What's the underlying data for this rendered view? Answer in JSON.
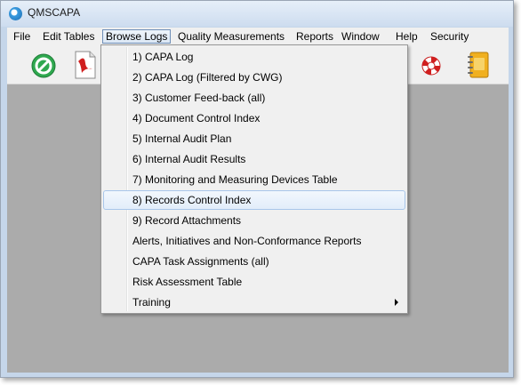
{
  "window": {
    "title": "QMSCAPA"
  },
  "menubar": [
    {
      "label": "File"
    },
    {
      "label": "Edit Tables"
    },
    {
      "label": "Browse Logs"
    },
    {
      "label": "Quality Measurements"
    },
    {
      "label": "Reports"
    },
    {
      "label": "Window"
    },
    {
      "label": "Help"
    },
    {
      "label": "Security"
    }
  ],
  "toolbar": {
    "buttons": [
      {
        "icon": "exit-icon",
        "color": "#2fa84f"
      },
      {
        "icon": "pdf-icon",
        "color": "#d01f1f"
      },
      {
        "icon": "lifebuoy-icon",
        "color": "#d01f1f"
      },
      {
        "icon": "notebook-icon",
        "color": "#f0b020"
      }
    ]
  },
  "dropdown": {
    "items": [
      {
        "label": "1) CAPA Log"
      },
      {
        "label": "2) CAPA Log (Filtered by CWG)"
      },
      {
        "label": "3) Customer Feed-back (all)"
      },
      {
        "label": "4) Document Control Index"
      },
      {
        "label": "5) Internal Audit Plan"
      },
      {
        "label": "6) Internal Audit Results"
      },
      {
        "label": "7) Monitoring and Measuring Devices Table"
      },
      {
        "label": "8) Records Control Index"
      },
      {
        "label": "9) Record Attachments"
      },
      {
        "label": "Alerts, Initiatives and Non-Conformance Reports"
      },
      {
        "label": "CAPA Task Assignments (all)"
      },
      {
        "label": "Risk Assessment Table"
      },
      {
        "label": "Training"
      }
    ],
    "highlighted_index": 7
  }
}
